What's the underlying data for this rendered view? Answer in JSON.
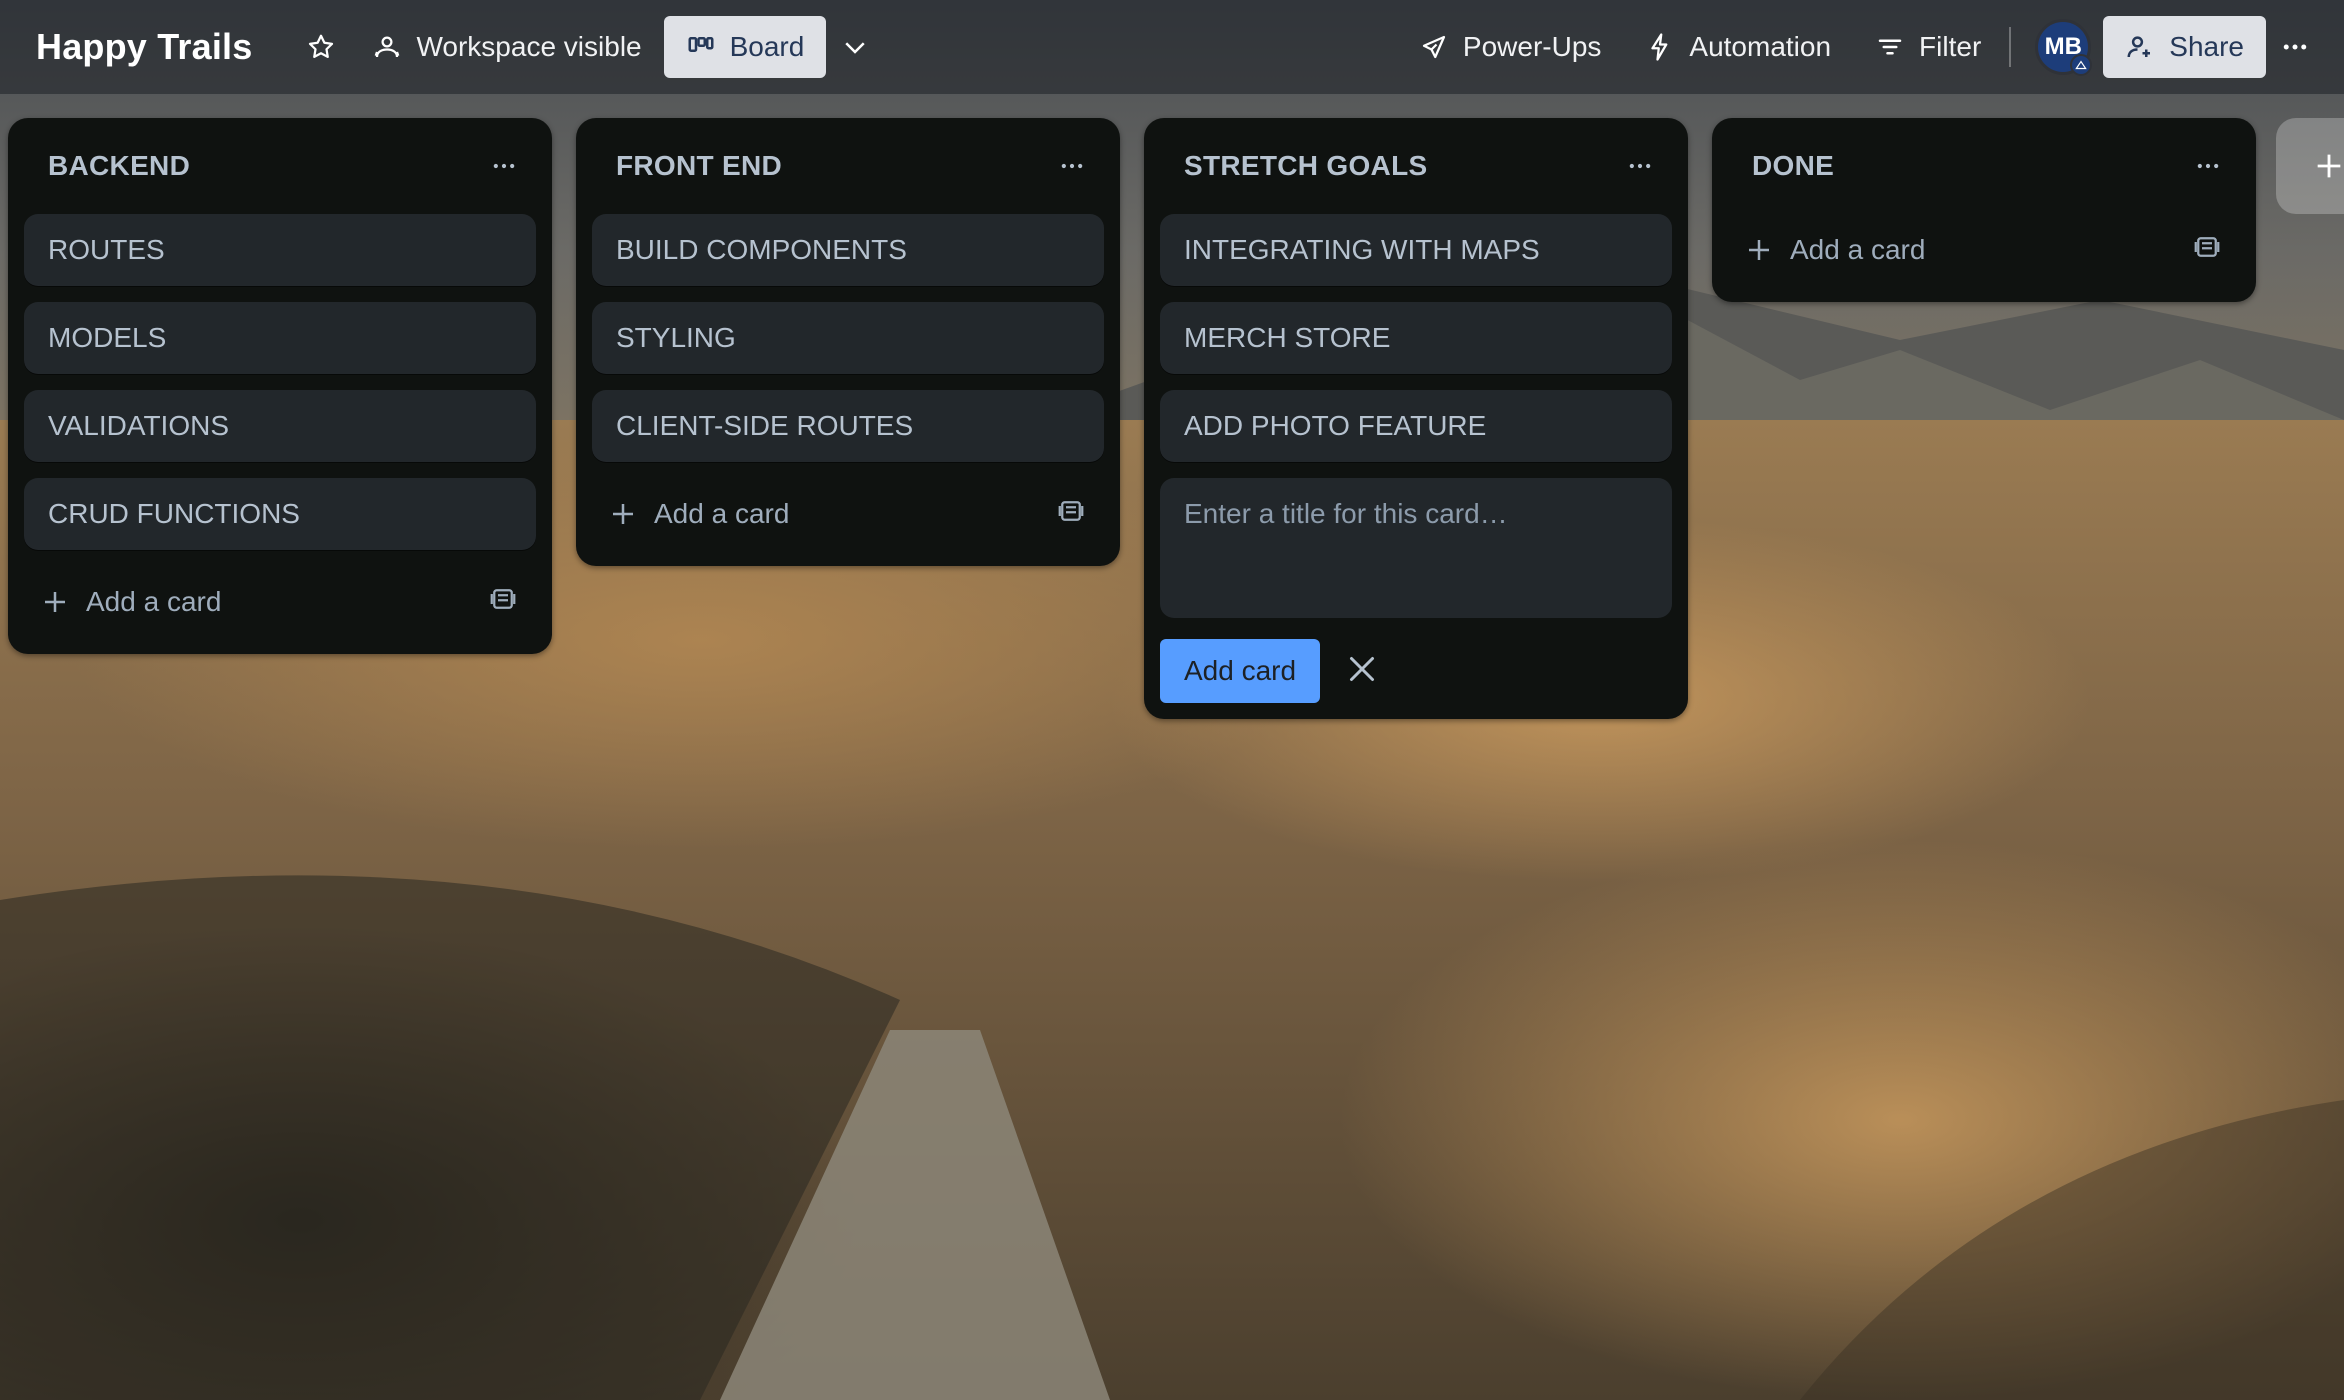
{
  "header": {
    "board_title": "Happy Trails",
    "workspace_label": "Workspace visible",
    "board_view_label": "Board",
    "powerups_label": "Power-Ups",
    "automation_label": "Automation",
    "filter_label": "Filter",
    "avatar_initials": "MB",
    "share_label": "Share"
  },
  "lists": [
    {
      "title": "BACKEND",
      "cards": [
        "ROUTES",
        "MODELS",
        "VALIDATIONS",
        "CRUD FUNCTIONS"
      ],
      "add_label": "Add a card"
    },
    {
      "title": "FRONT END",
      "cards": [
        "BUILD COMPONENTS",
        "STYLING",
        "CLIENT-SIDE ROUTES"
      ],
      "add_label": "Add a card"
    },
    {
      "title": "STRETCH GOALS",
      "cards": [
        "INTEGRATING WITH MAPS",
        "MERCH STORE",
        "ADD PHOTO FEATURE"
      ],
      "composer_placeholder": "Enter a title for this card…",
      "composer_submit": "Add card"
    },
    {
      "title": "DONE",
      "cards": [],
      "add_label": "Add a card"
    }
  ],
  "colors": {
    "list_bg": "#101204",
    "card_bg": "#22272b",
    "text": "#b6c2cf",
    "primary_button": "#579dff"
  }
}
